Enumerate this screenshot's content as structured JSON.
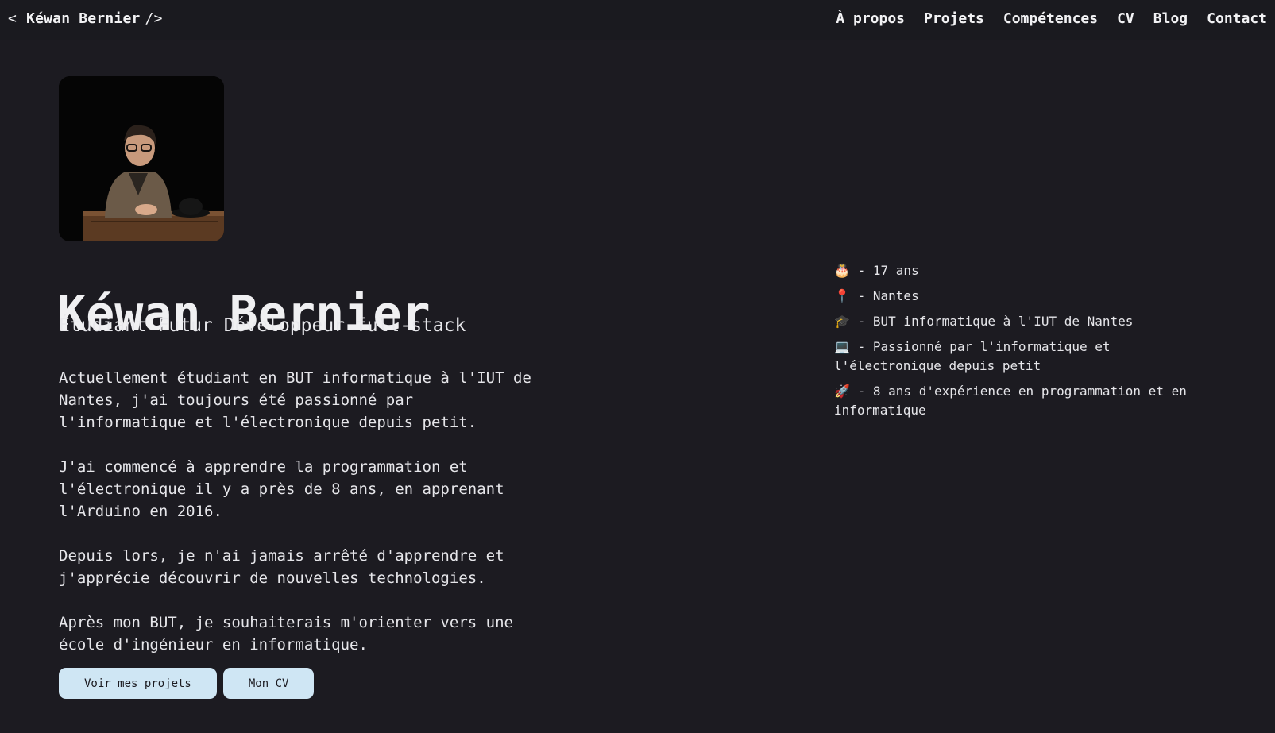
{
  "header": {
    "back_glyph": "<",
    "brand_name": "Kéwan Bernier",
    "brand_tag": "/>",
    "nav": [
      "À propos",
      "Projets",
      "Compétences",
      "CV",
      "Blog",
      "Contact"
    ]
  },
  "hero": {
    "name": "Kéwan Bernier",
    "subtitle": "Étudiant Futur Développeur full-stack",
    "bio": [
      "Actuellement étudiant en BUT informatique à l'IUT de Nantes, j'ai toujours été passionné par l'informatique et l'électronique depuis petit.",
      "J'ai commencé à apprendre la programmation et l'électronique il y a près de 8 ans, en apprenant l'Arduino en 2016.",
      "Depuis lors, je n'ai jamais arrêté d'apprendre et j'apprécie découvrir de nouvelles technologies.",
      "Après mon BUT, je souhaiterais m'orienter vers une école d'ingénieur en informatique."
    ],
    "buttons": {
      "projects": "Voir mes projets",
      "cv": "Mon CV"
    }
  },
  "facts": [
    {
      "icon": "🎂",
      "icon_name": "birthday-cake-icon",
      "text": " - 17 ans"
    },
    {
      "icon": "📍",
      "icon_name": "location-pin-icon",
      "text": " - Nantes"
    },
    {
      "icon": "🎓",
      "icon_name": "graduation-cap-icon",
      "text": " - BUT informatique à l'IUT de Nantes"
    },
    {
      "icon": "💻",
      "icon_name": "laptop-icon",
      "text": " - Passionné par l'informatique et l'électronique depuis petit"
    },
    {
      "icon": "🚀",
      "icon_name": "rocket-icon",
      "text": " - 8 ans d'expérience en programmation et en informatique"
    }
  ],
  "colors": {
    "background": "#1c1b21",
    "text": "#ececef",
    "button_bg": "#cfe6f4",
    "button_text": "#1c1b21"
  }
}
